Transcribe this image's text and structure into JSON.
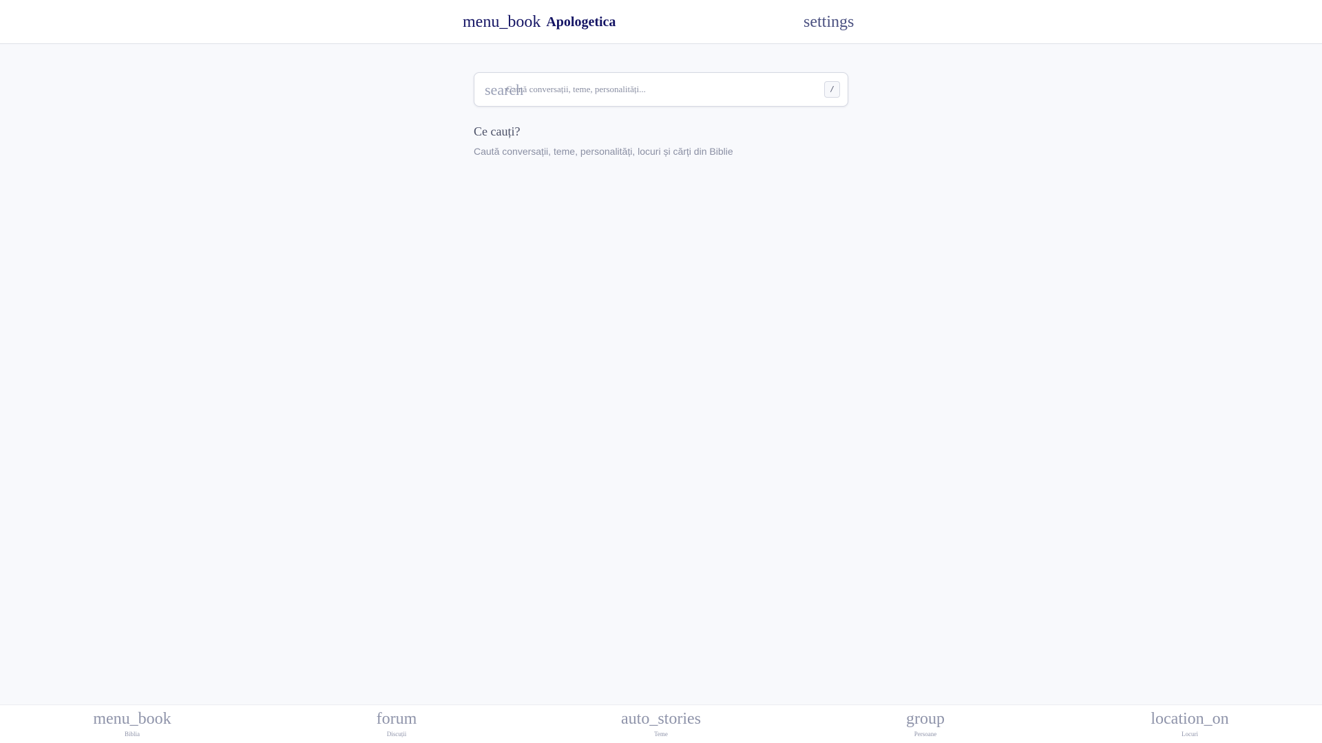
{
  "header": {
    "logo_icon": "menu_book",
    "title": "Apologetica",
    "settings_icon": "settings"
  },
  "search": {
    "icon": "search",
    "placeholder": "Caută conversații, teme, personalități...",
    "value": "",
    "shortcut": "/"
  },
  "empty_state": {
    "title": "Ce cauți?",
    "subtitle": "Caută conversații, teme, personalități, locuri și cărți din Biblie"
  },
  "bottom_nav": {
    "items": [
      {
        "icon": "menu_book",
        "label": "Biblia"
      },
      {
        "icon": "forum",
        "label": "Discuții"
      },
      {
        "icon": "auto_stories",
        "label": "Teme"
      },
      {
        "icon": "group",
        "label": "Persoane"
      },
      {
        "icon": "location_on",
        "label": "Locuri"
      }
    ]
  },
  "colors": {
    "background": "#f8f9fc",
    "brand": "#141464",
    "muted": "#8f94aa"
  }
}
